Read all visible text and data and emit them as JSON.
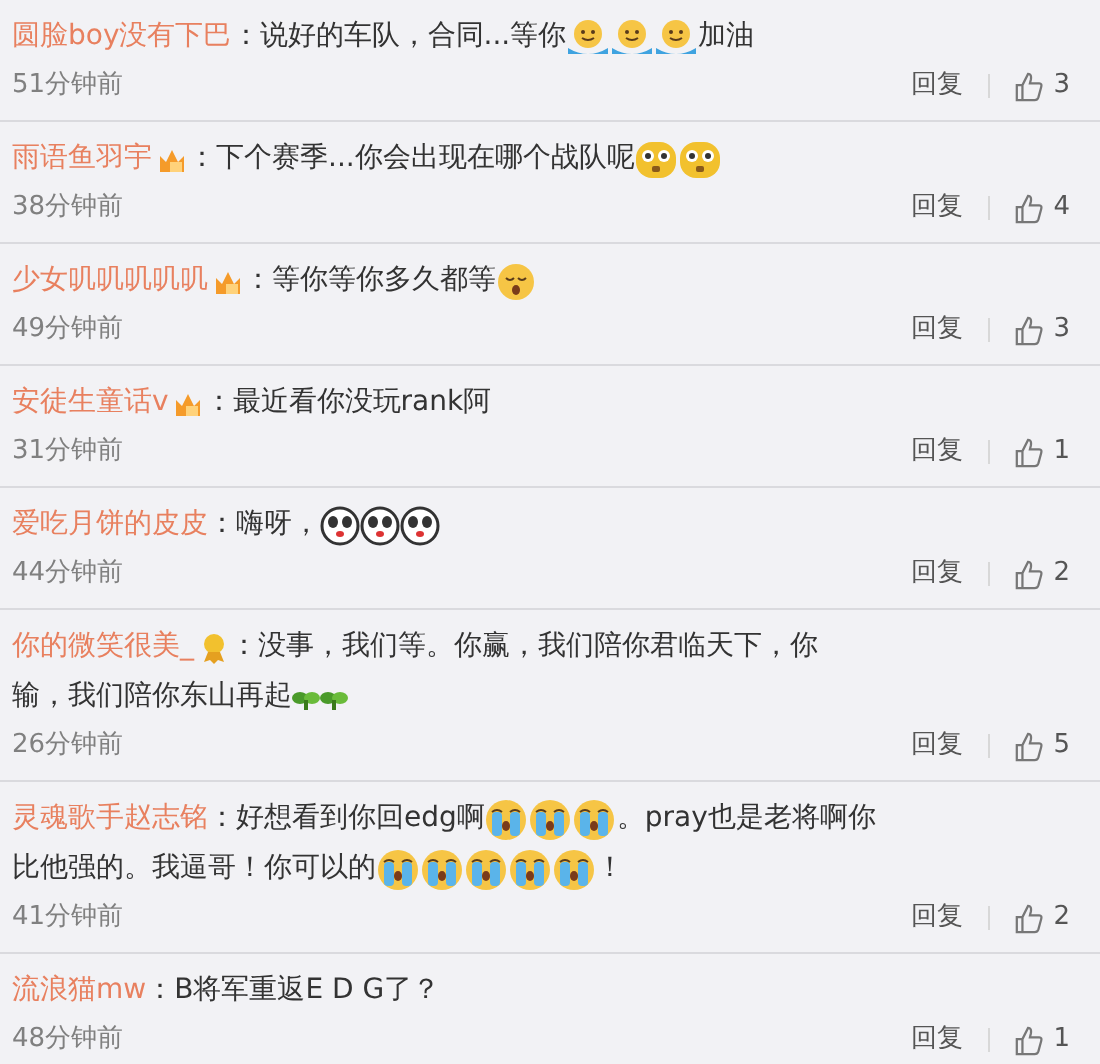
{
  "comments": [
    {
      "user": "圆脸boy没有下巴",
      "content": [
        {
          "kind": "text",
          "text": "：说好的车队，合同...等你"
        },
        {
          "kind": "hug"
        },
        {
          "kind": "hug"
        },
        {
          "kind": "hug"
        },
        {
          "kind": "text",
          "text": "加油"
        }
      ],
      "time": "51分钟前",
      "reply": "回复",
      "likes": "3"
    },
    {
      "user": "雨语鱼羽宇",
      "badge": {
        "kind": "crown"
      },
      "content": [
        {
          "kind": "text",
          "text": "：下个赛季...你会出现在哪个战队呢"
        },
        {
          "kind": "awe"
        },
        {
          "kind": "awe"
        }
      ],
      "time": "38分钟前",
      "reply": "回复",
      "likes": "4"
    },
    {
      "user": "少女叽叽叽叽叽",
      "badge": {
        "kind": "crown"
      },
      "content": [
        {
          "kind": "text",
          "text": "：等你等你多久都等"
        },
        {
          "kind": "sleepy"
        }
      ],
      "time": "49分钟前",
      "reply": "回复",
      "likes": "3"
    },
    {
      "user": "安徒生童话v",
      "badge": {
        "kind": "crown"
      },
      "content": [
        {
          "kind": "text",
          "text": "：最近看你没玩rank阿"
        }
      ],
      "time": "31分钟前",
      "reply": "回复",
      "likes": "1"
    },
    {
      "user": "爱吃月饼的皮皮",
      "content": [
        {
          "kind": "text",
          "text": "：嗨呀，"
        },
        {
          "kind": "panda"
        },
        {
          "kind": "panda"
        },
        {
          "kind": "panda"
        }
      ],
      "time": "44分钟前",
      "reply": "回复",
      "likes": "2"
    },
    {
      "user": "你的微笑很美_",
      "badge": {
        "kind": "medal"
      },
      "content": [
        {
          "kind": "text",
          "text": "：没事，我们等。你赢，我们陪你君临天下，你"
        },
        {
          "kind": "text",
          "text": "输，我们陪你东山再起"
        },
        {
          "kind": "sprout"
        },
        {
          "kind": "sprout"
        }
      ],
      "time": "26分钟前",
      "reply": "回复",
      "likes": "5"
    },
    {
      "user": "灵魂歌手赵志铭",
      "content": [
        {
          "kind": "text",
          "text": "：好想看到你回edg啊"
        },
        {
          "kind": "cry"
        },
        {
          "kind": "cry"
        },
        {
          "kind": "cry"
        },
        {
          "kind": "text",
          "text": "。pray也是老将啊你"
        },
        {
          "kind": "text",
          "text": "比他强的。我逼哥！你可以的"
        },
        {
          "kind": "cry"
        },
        {
          "kind": "cry"
        },
        {
          "kind": "cry"
        },
        {
          "kind": "cry"
        },
        {
          "kind": "cry"
        },
        {
          "kind": "text",
          "text": "！"
        }
      ],
      "time": "41分钟前",
      "reply": "回复",
      "likes": "2"
    },
    {
      "user": "流浪猫mw",
      "content": [
        {
          "kind": "text",
          "text": "：B将军重返E D G了？"
        }
      ],
      "time": "48分钟前",
      "reply": "回复",
      "likes": "1"
    }
  ]
}
